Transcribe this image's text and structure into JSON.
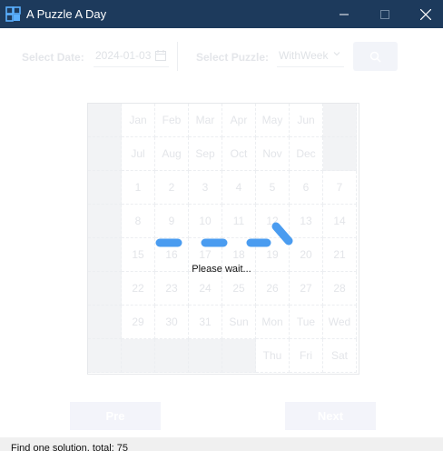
{
  "window": {
    "title": "A Puzzle A Day"
  },
  "toolbar": {
    "date_label": "Select Date:",
    "date_value": "2024-01-03",
    "puzzle_label": "Select Puzzle:",
    "puzzle_value": "WithWeek"
  },
  "board": {
    "rows": [
      [
        "",
        "Jan",
        "Feb",
        "Mar",
        "Apr",
        "May",
        "Jun",
        ""
      ],
      [
        "",
        "Jul",
        "Aug",
        "Sep",
        "Oct",
        "Nov",
        "Dec",
        ""
      ],
      [
        "",
        "1",
        "2",
        "3",
        "4",
        "5",
        "6",
        "7"
      ],
      [
        "",
        "8",
        "9",
        "10",
        "11",
        "12",
        "13",
        "14"
      ],
      [
        "",
        "15",
        "16",
        "17",
        "18",
        "19",
        "20",
        "21"
      ],
      [
        "",
        "22",
        "23",
        "24",
        "25",
        "26",
        "27",
        "28"
      ],
      [
        "",
        "29",
        "30",
        "31",
        "Sun",
        "Mon",
        "Tue",
        "Wed"
      ],
      [
        "",
        "",
        "",
        "",
        "",
        "Thu",
        "Fri",
        "Sat"
      ]
    ]
  },
  "loading": {
    "text": "Please wait..."
  },
  "nav": {
    "pre_label": "Pre",
    "next_label": "Next"
  },
  "status": {
    "text": "Find one solution, total: 75"
  },
  "colors": {
    "titlebar": "#1d3a5c",
    "spinner": "#4a9cf0"
  }
}
